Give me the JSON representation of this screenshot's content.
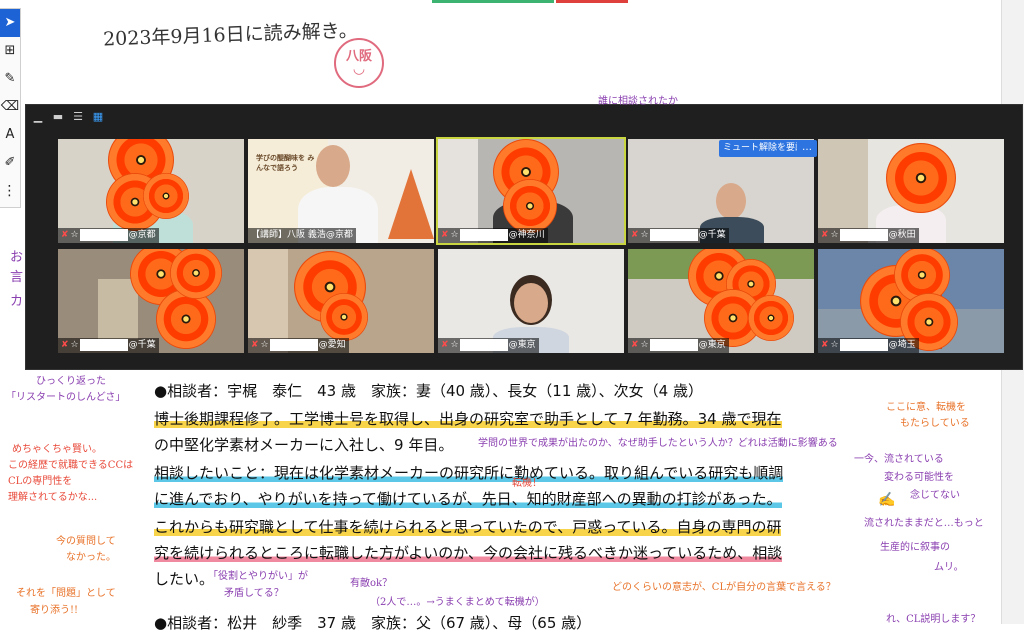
{
  "document": {
    "handwritten_title": "2023年9月16日に読み解き。",
    "stamp_text": "八阪",
    "lines": [
      "●相談者：宇梶　泰仁　43 歳　家族：妻（40 歳）、長女（11 歳）、次女（4 歳）",
      "博士後期課程修了。工学博士号を取得し、出身の研究室で助手として 7 年勤務。34 歳で現在",
      "の中堅化学素材メーカーに入社し、9 年目。",
      "相談したいこと：現在は化学素材メーカーの研究所に勤めている。取り組んでいる研究も順調",
      "に進んでおり、やりがいを持って働けているが、先日、知的財産部への異動の打診があった。",
      "これからも研究職として仕事を続けられると思っていたので、戸惑っている。自身の専門の研",
      "究を続けられるところに転職した方がよいのか、今の会社に残るべきか迷っているため、相談",
      "したい。",
      "●相談者：松井　紗季　37 歳　家族：父（67 歳）、母（65 歳）"
    ],
    "annotations": {
      "left_1": "ひっくり返った",
      "left_2": "「リスタートのしんどさ」",
      "left_3": "めちゃくちゃ賢い。",
      "left_4": "この経歴で就職できるCCは",
      "left_5": "CLの専門性を",
      "left_6": "理解されてるかな...",
      "left_7": "今の質問して",
      "left_8": "なかった。",
      "left_9": "それを「問題」として",
      "left_10": "寄り添う!!",
      "mid_1": "学問の世界で成果が出たのか、なぜ助手したという人か？どれは活動に影響ある",
      "mid_2": "転機！",
      "mid_3": "「役割とやりがい」が",
      "mid_4": "矛盾してる？",
      "mid_5": "有敵ok？",
      "mid_6": "（2人で…。→うまくまとめて転機が）",
      "mid_7": "どのくらいの意志が、CLが自分の言葉で言える？",
      "right_1": "ここに意、転機を",
      "right_2": "もたらしている",
      "right_3": "一今、流されている",
      "right_4": "変わる可能性を",
      "right_5": "念じてない",
      "right_6": "流されたままだと…もっと",
      "right_7": "生産的に叙事の",
      "right_8": "ムリ。",
      "top_red": "誰に相談されたか",
      "bottom_right": "れ、CL説明します？"
    }
  },
  "toolbar": {
    "tools": [
      "select-arrow",
      "add-box",
      "pen",
      "eraser",
      "text-A",
      "stamp-cursor",
      "more-dots"
    ]
  },
  "zoom": {
    "view_icons": [
      "minimize",
      "single",
      "two-row",
      "grid"
    ],
    "participants": [
      {
        "id": "p1",
        "name": "@京都"
      },
      {
        "id": "p2",
        "name": "【講師】八阪 義浩@京都"
      },
      {
        "id": "p3",
        "name": "@神奈川"
      },
      {
        "id": "p4",
        "name": "@千葉"
      },
      {
        "id": "p5",
        "name": "@秋田"
      },
      {
        "id": "p6",
        "name": "@千葉"
      },
      {
        "id": "p7",
        "name": "@愛知"
      },
      {
        "id": "p8",
        "name": "@東京"
      },
      {
        "id": "p9",
        "name": "@東京"
      },
      {
        "id": "p10",
        "name": "@埼玉"
      }
    ],
    "unmute_request": "ミュート解除を要請",
    "more": "…",
    "slide": {
      "title": "学びの醍醐味を みんなで語ろう"
    }
  }
}
